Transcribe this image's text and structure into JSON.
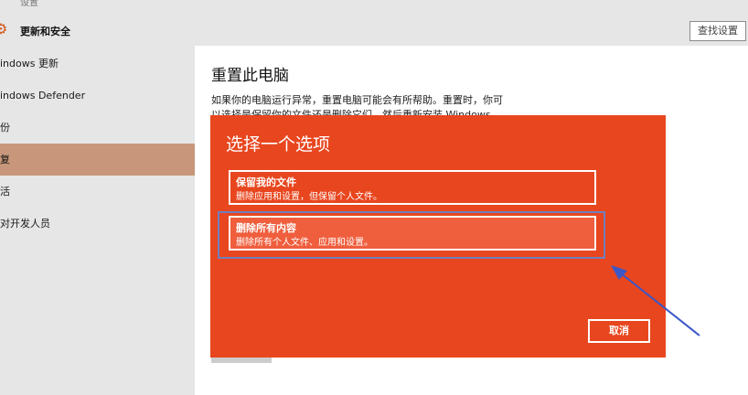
{
  "top_crumb": "设置",
  "header": {
    "title": "更新和安全",
    "icon": "gear-icon"
  },
  "search": {
    "label": "查找设置"
  },
  "sidebar": {
    "items": [
      {
        "label": "indows 更新",
        "active": false
      },
      {
        "label": "indows Defender",
        "active": false
      },
      {
        "label": "份",
        "active": false
      },
      {
        "label": "复",
        "active": true
      },
      {
        "label": "活",
        "active": false
      },
      {
        "label": "对开发人员",
        "active": false
      }
    ]
  },
  "content": {
    "title": "重置此电脑",
    "desc_line1": "如果你的电脑运行异常，重置电脑可能会有所帮助。重置时，你可",
    "desc_line2": "以选择是保留你的文件还是删除它们，然后重新安装 Windows。"
  },
  "dialog": {
    "title": "选择一个选项",
    "options": [
      {
        "label": "保留我的文件",
        "sub": "删除应用和设置，但保留个人文件。"
      },
      {
        "label": "删除所有内容",
        "sub": "删除所有个人文件、应用和设置。"
      }
    ],
    "cancel_label": "取消"
  },
  "colors": {
    "dialog_bg": "#e8461e",
    "highlight_sidebar": "#c8977b",
    "focus_ring": "#6f7fbf"
  }
}
